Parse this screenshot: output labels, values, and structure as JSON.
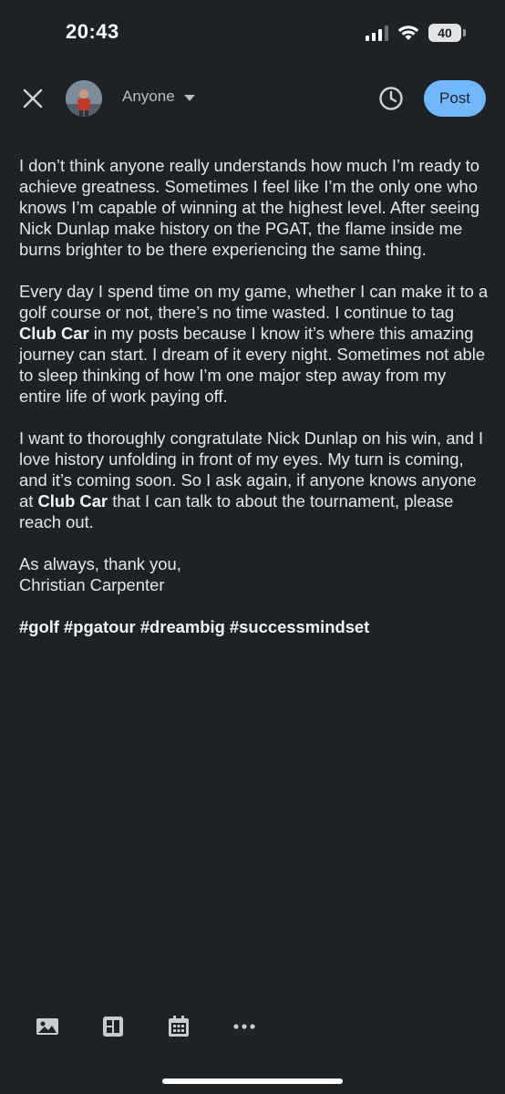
{
  "status_bar": {
    "time": "20:43",
    "battery": "40"
  },
  "header": {
    "audience": "Anyone",
    "post_label": "Post"
  },
  "post": {
    "p1": "I don’t think anyone really understands how much I’m ready to achieve greatness. Sometimes I feel like I’m the only one who knows I’m capable of winning at the highest level. After seeing Nick Dunlap make history on the PGAT, the flame inside me burns brighter to be there experiencing the same thing.",
    "p2_a": "Every day I spend time on my game, whether I can make it to a golf course or not, there’s no time wasted. I continue to tag ",
    "mention1": "Club Car",
    "p2_b": " in my posts because I know it’s where this amazing journey can start. I dream of it every night. Sometimes not able to sleep thinking of how I’m one major step away from my entire life of work paying off.",
    "p3_a": "I want to thoroughly congratulate Nick Dunlap on his win, and I love history unfolding in front of my eyes. My turn is coming, and it’s coming soon. So I ask again, if anyone knows anyone at ",
    "mention2": "Club Car",
    "p3_b": " that I can talk to about the tournament, please reach out.",
    "signoff": "As always, thank you,",
    "author": "Christian Carpenter",
    "hashtags": "#golf #pgatour #dreambig #successmindset"
  },
  "icons": [
    "image-icon",
    "template-icon",
    "calendar-icon",
    "more-icon"
  ],
  "colors": {
    "background": "#1d2226",
    "accent": "#71b7fb",
    "text": "#e6e6e6"
  }
}
